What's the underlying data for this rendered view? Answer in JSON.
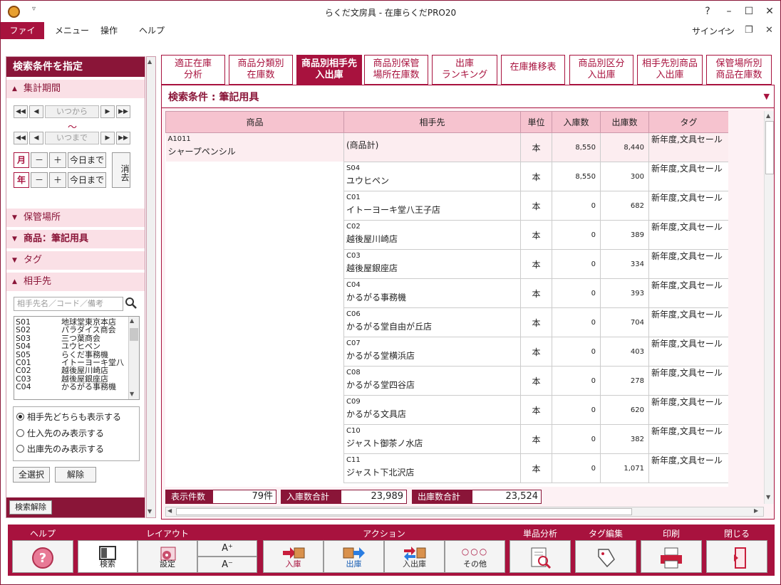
{
  "title": "らくだ文房具 - 在庫らくだPRO20",
  "quick_access": "▿",
  "window_controls": {
    "help": "?",
    "minimize": "–",
    "maximize": "☐",
    "close": "✕"
  },
  "menu": {
    "file": "ファイル",
    "menu": "メニュー",
    "operation": "操作",
    "help": "ヘルプ"
  },
  "signin": "サインイン",
  "sub_controls": {
    "minimize": "–",
    "restore": "❐",
    "close": "✕"
  },
  "left_panel": {
    "header": "検索条件を指定",
    "period_section": "集計期間",
    "from_placeholder": "いつから",
    "tilde": "～",
    "to_placeholder": "いつまで",
    "nav": {
      "first": "◀◀",
      "prev": "◀",
      "next": "▶",
      "last": "▶▶"
    },
    "month": "月",
    "year": "年",
    "minus": "－",
    "plus": "＋",
    "today": "今日まで",
    "clear": "消去",
    "location_section": "保管場所",
    "product_section": "商品：筆記用具",
    "tag_section": "タグ",
    "partner_section": "相手先",
    "partner_search_placeholder": "相手先名／コード／備考",
    "partners": [
      {
        "code": "S01",
        "name": "地球堂東京本店"
      },
      {
        "code": "S02",
        "name": "パラダイス商会"
      },
      {
        "code": "S03",
        "name": "三つ葉商会"
      },
      {
        "code": "S04",
        "name": "ユウヒペン"
      },
      {
        "code": "S05",
        "name": "らくだ事務機"
      },
      {
        "code": "C01",
        "name": "イトーヨーキ堂八"
      },
      {
        "code": "C02",
        "name": "越後屋川崎店"
      },
      {
        "code": "C03",
        "name": "越後屋銀座店"
      },
      {
        "code": "C04",
        "name": "かるがる事務機"
      }
    ],
    "radio_both": "相手先どちらも表示する",
    "radio_in": "仕入先のみ表示する",
    "radio_out": "出庫先のみ表示する",
    "select_all": "全選択",
    "deselect": "解除",
    "clear_search": "検索解除"
  },
  "tabs": [
    {
      "l1": "適正在庫",
      "l2": "分析"
    },
    {
      "l1": "商品分類別",
      "l2": "在庫数"
    },
    {
      "l1": "商品別相手先",
      "l2": "入出庫"
    },
    {
      "l1": "商品別保管",
      "l2": "場所在庫数"
    },
    {
      "l1": "出庫",
      "l2": "ランキング"
    },
    {
      "l1": "在庫推移表",
      "l2": ""
    },
    {
      "l1": "商品別区分",
      "l2": "入出庫"
    },
    {
      "l1": "相手先別商品",
      "l2": "入出庫"
    },
    {
      "l1": "保管場所別",
      "l2": "商品在庫数"
    }
  ],
  "condition": "検索条件 : 筆記用具",
  "table": {
    "headers": {
      "product": "商品",
      "partner": "相手先",
      "unit": "単位",
      "in": "入庫数",
      "out": "出庫数",
      "tag": "タグ"
    },
    "product_code": "A1011",
    "product_name": "シャープペンシル",
    "rows": [
      {
        "code": "",
        "name": "(商品計)",
        "unit": "本",
        "in": "8,550",
        "out": "8,440",
        "tag": "新年度,文具セール"
      },
      {
        "code": "S04",
        "name": "ユウヒペン",
        "unit": "本",
        "in": "8,550",
        "out": "300",
        "tag": "新年度,文具セール"
      },
      {
        "code": "C01",
        "name": "イトーヨーキ堂八王子店",
        "unit": "本",
        "in": "0",
        "out": "682",
        "tag": "新年度,文具セール"
      },
      {
        "code": "C02",
        "name": "越後屋川崎店",
        "unit": "本",
        "in": "0",
        "out": "389",
        "tag": "新年度,文具セール"
      },
      {
        "code": "C03",
        "name": "越後屋銀座店",
        "unit": "本",
        "in": "0",
        "out": "334",
        "tag": "新年度,文具セール"
      },
      {
        "code": "C04",
        "name": "かるがる事務機",
        "unit": "本",
        "in": "0",
        "out": "393",
        "tag": "新年度,文具セール"
      },
      {
        "code": "C06",
        "name": "かるがる堂自由が丘店",
        "unit": "本",
        "in": "0",
        "out": "704",
        "tag": "新年度,文具セール"
      },
      {
        "code": "C07",
        "name": "かるがる堂横浜店",
        "unit": "本",
        "in": "0",
        "out": "403",
        "tag": "新年度,文具セール"
      },
      {
        "code": "C08",
        "name": "かるがる堂四谷店",
        "unit": "本",
        "in": "0",
        "out": "278",
        "tag": "新年度,文具セール"
      },
      {
        "code": "C09",
        "name": "かるがる文具店",
        "unit": "本",
        "in": "0",
        "out": "620",
        "tag": "新年度,文具セール"
      },
      {
        "code": "C10",
        "name": "ジャスト御茶ノ水店",
        "unit": "本",
        "in": "0",
        "out": "382",
        "tag": "新年度,文具セール"
      },
      {
        "code": "C11",
        "name": "ジャスト下北沢店",
        "unit": "本",
        "in": "0",
        "out": "1,071",
        "tag": "新年度,文具セール"
      }
    ]
  },
  "totals": {
    "count_label": "表示件数",
    "count": "79件",
    "in_label": "入庫数合計",
    "in": "23,989",
    "out_label": "出庫数合計",
    "out": "23,524"
  },
  "toolbar": {
    "groups": {
      "help": "ヘルプ",
      "layout": "レイアウト",
      "action": "アクション",
      "analysis": "単品分析",
      "tag_edit": "タグ編集",
      "print": "印刷",
      "close": "閉じる"
    },
    "search": "検索",
    "settings": "設定",
    "font_up": "A⁺",
    "font_down": "A⁻",
    "in": "入庫",
    "out": "出庫",
    "inout": "入出庫",
    "other": "その他",
    "dots": "○○○"
  },
  "colors": {
    "accent": "#a8123e",
    "dark": "#8a1538",
    "header_bg": "#f6c3cf",
    "section_bg": "#fae0e6"
  }
}
